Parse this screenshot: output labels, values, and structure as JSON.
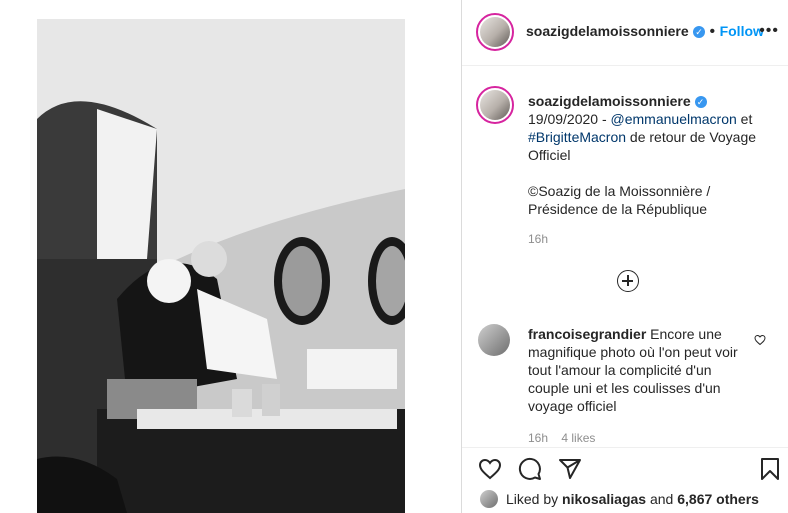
{
  "post": {
    "author": "soazigdelamoissonniere",
    "separator": "•",
    "follow_label": "Follow",
    "more_label": "•••"
  },
  "caption": {
    "author": "soazigdelamoissonniere",
    "date_prefix": "19/09/2020 - ",
    "mention": "@emmanuelmacron",
    "mid_text": " et ",
    "hashtag": "#BrigitteMacron",
    "rest": " de retour de Voyage Officiel",
    "credit_line1": "©Soazig de la Moissonnière /",
    "credit_line2": "Présidence de la République",
    "time": "16h"
  },
  "comment": {
    "author": "francoisegrandier",
    "text": " Encore une magnifique photo où l'on peut voir tout l'amour la complicité d'un couple uni et les coulisses d'un voyage officiel",
    "time": "16h",
    "likes": "4 likes"
  },
  "likes_line": {
    "prefix": "Liked by ",
    "user": "nikosaliagas",
    "mid": " and ",
    "count": "6,867 others"
  },
  "icons": [
    "heart-icon",
    "comment-icon",
    "share-icon",
    "bookmark-icon",
    "add-comments-icon",
    "more-options-icon"
  ]
}
